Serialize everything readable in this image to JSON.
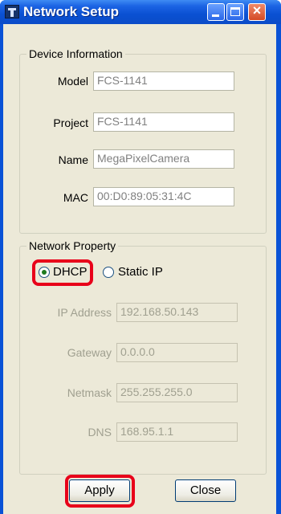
{
  "window": {
    "title": "Network Setup",
    "close_glyph": "×"
  },
  "device_info": {
    "legend": "Device Information",
    "fields": [
      {
        "label": "Model",
        "value": "FCS-1141"
      },
      {
        "label": "Project",
        "value": "FCS-1141"
      },
      {
        "label": "Name",
        "value": "MegaPixelCamera"
      },
      {
        "label": "MAC",
        "value": "00:D0:89:05:31:4C"
      }
    ]
  },
  "network": {
    "legend": "Network Property",
    "dhcp_label": "DHCP",
    "static_label": "Static IP",
    "selected": "DHCP",
    "fields": [
      {
        "label": "IP Address",
        "value": "192.168.50.143"
      },
      {
        "label": "Gateway",
        "value": "0.0.0.0"
      },
      {
        "label": "Netmask",
        "value": "255.255.255.0"
      },
      {
        "label": "DNS",
        "value": "168.95.1.1"
      }
    ]
  },
  "buttons": {
    "apply": "Apply",
    "close": "Close"
  },
  "colors": {
    "title_bar": "#0a52d6",
    "highlight": "#e8001a",
    "dialog_bg": "#ece9d8"
  }
}
